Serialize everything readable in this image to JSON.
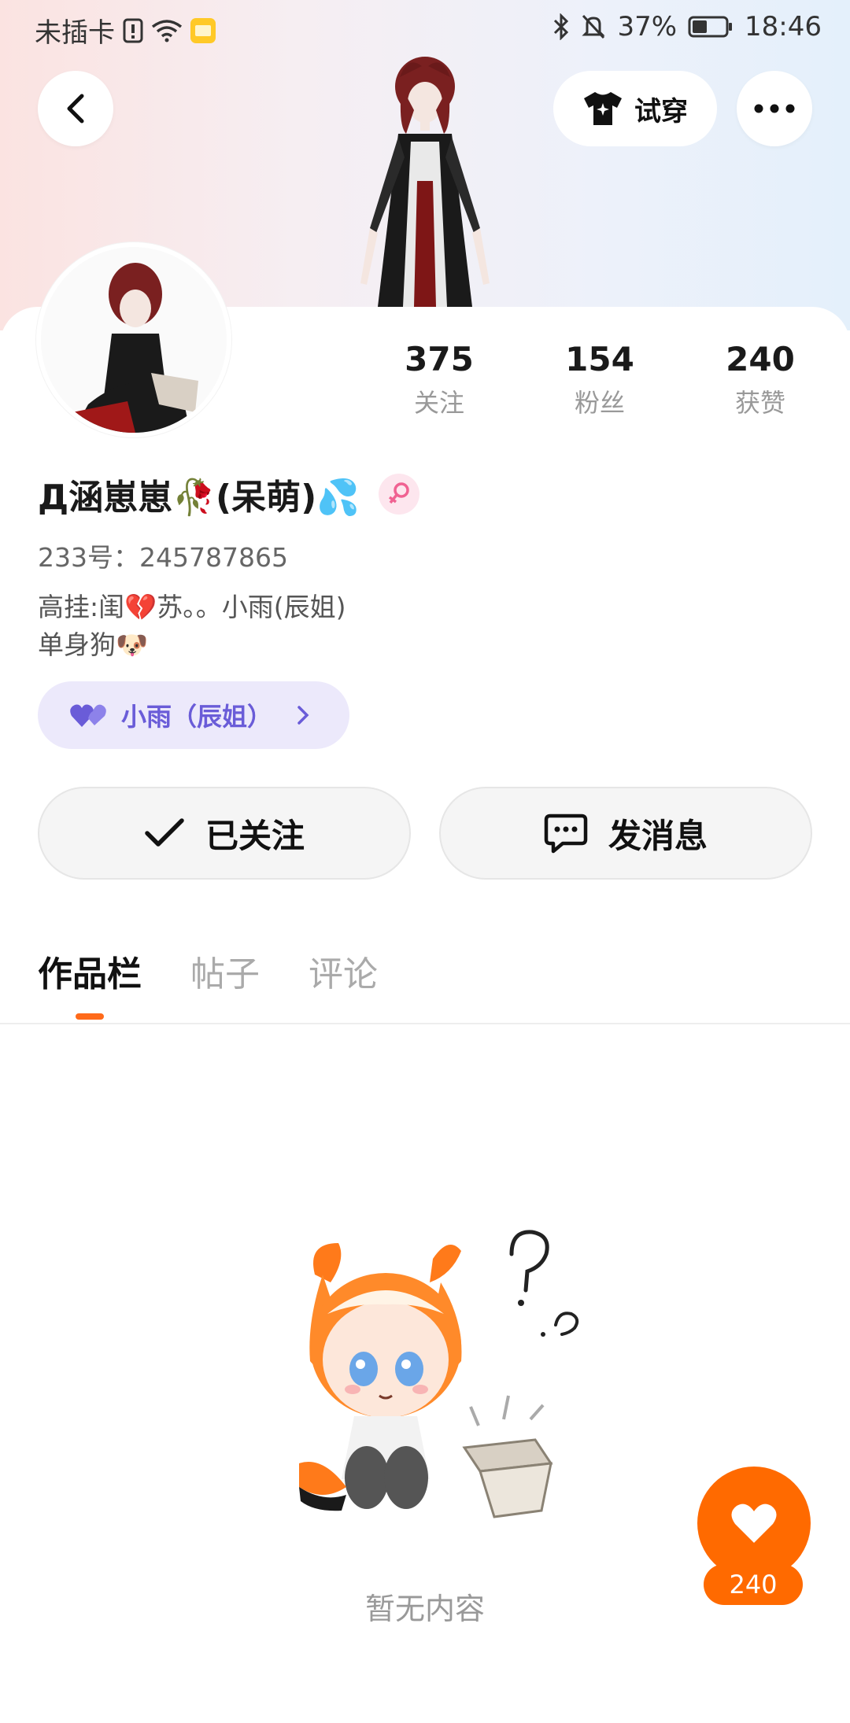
{
  "status_bar": {
    "carrier": "未插卡",
    "battery": "37%",
    "time": "18:46"
  },
  "header": {
    "try_on_label": "试穿"
  },
  "profile": {
    "stats": [
      {
        "value": "375",
        "label": "关注"
      },
      {
        "value": "154",
        "label": "粉丝"
      },
      {
        "value": "240",
        "label": "获赞"
      }
    ],
    "name": "Д涵崽崽🥀(呆萌)💦",
    "uid": "233号：245787865",
    "bio_line1": "高挂:闺💔苏。。小雨(辰姐)",
    "bio_line2": "单身狗🐶",
    "relation_label": "小雨（辰姐）"
  },
  "actions": {
    "followed_label": "已关注",
    "message_label": "发消息"
  },
  "tabs": [
    {
      "label": "作品栏",
      "active": true
    },
    {
      "label": "帖子",
      "active": false
    },
    {
      "label": "评论",
      "active": false
    }
  ],
  "empty_state": {
    "text": "暂无内容"
  },
  "like_fab": {
    "count": "240"
  },
  "colors": {
    "accent": "#ff6a00",
    "relation_bg": "#ece9fb",
    "relation_text": "#6a5cd8"
  }
}
